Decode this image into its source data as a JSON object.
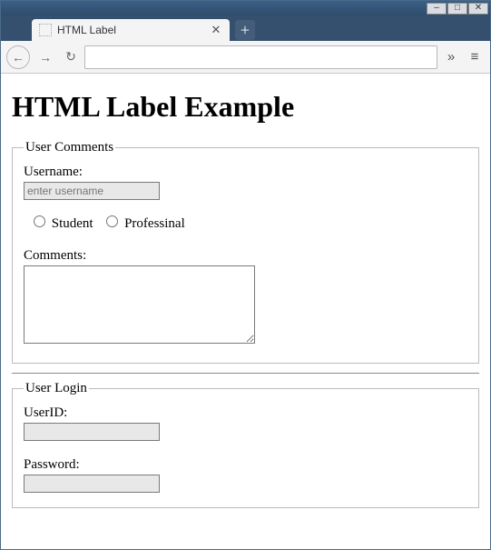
{
  "window": {
    "tab_title": "HTML Label",
    "close": "✕",
    "new_tab": "+"
  },
  "nav": {
    "back": "←",
    "forward": "→",
    "reload": "↻",
    "overflow": "»",
    "menu": "≡"
  },
  "page": {
    "heading": "HTML Label Example",
    "comments": {
      "legend": "User Comments",
      "username_label": "Username:",
      "username_placeholder": "enter username",
      "radio_student": "Student",
      "radio_professional": "Professinal",
      "comments_label": "Comments:"
    },
    "login": {
      "legend": "User Login",
      "userid_label": "UserID:",
      "password_label": "Password:"
    }
  }
}
